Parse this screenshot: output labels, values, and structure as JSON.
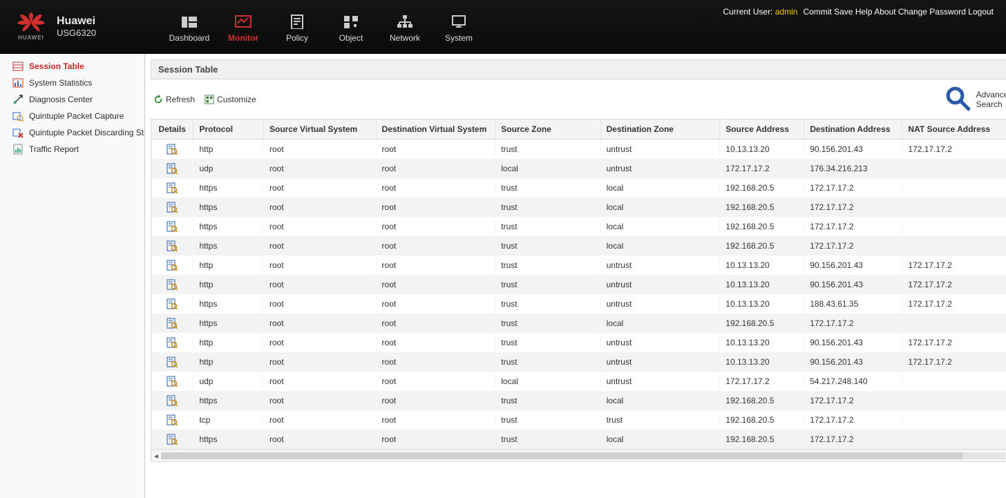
{
  "brand": {
    "name": "Huawei",
    "model": "USG6320",
    "logo_caption": "HUAWEI"
  },
  "top_right": {
    "current_user_label": "Current User:",
    "current_user": "admin",
    "links": [
      "Commit",
      "Save",
      "Help",
      "About",
      "Change Password",
      "Logout"
    ]
  },
  "nav": [
    {
      "label": "Dashboard",
      "id": "dashboard"
    },
    {
      "label": "Monitor",
      "id": "monitor",
      "active": true
    },
    {
      "label": "Policy",
      "id": "policy"
    },
    {
      "label": "Object",
      "id": "object"
    },
    {
      "label": "Network",
      "id": "network"
    },
    {
      "label": "System",
      "id": "system"
    }
  ],
  "sidebar": [
    {
      "label": "Session Table",
      "active": true,
      "icon": "session"
    },
    {
      "label": "System Statistics",
      "icon": "stats"
    },
    {
      "label": "Diagnosis Center",
      "icon": "diag"
    },
    {
      "label": "Quintuple Packet Capture",
      "icon": "pcap1"
    },
    {
      "label": "Quintuple Packet Discarding Statistics",
      "icon": "pcap2"
    },
    {
      "label": "Traffic Report",
      "icon": "report"
    }
  ],
  "panel": {
    "title": "Session Table",
    "refresh": "Refresh",
    "customize": "Customize",
    "advanced_search": "Advanced Search"
  },
  "columns": [
    "Details",
    "Protocol",
    "Source Virtual System",
    "Destination Virtual System",
    "Source Zone",
    "Destination Zone",
    "Source Address",
    "Destination Address",
    "NAT Source Address"
  ],
  "rows": [
    {
      "protocol": "http",
      "svs": "root",
      "dvs": "root",
      "sz": "trust",
      "dz": "untrust",
      "sa": "10.13.13.20",
      "da": "90.156.201.43",
      "nsa": "172.17.17.2"
    },
    {
      "protocol": "udp",
      "svs": "root",
      "dvs": "root",
      "sz": "local",
      "dz": "untrust",
      "sa": "172.17.17.2",
      "da": "176.34.216.213",
      "nsa": ""
    },
    {
      "protocol": "https",
      "svs": "root",
      "dvs": "root",
      "sz": "trust",
      "dz": "local",
      "sa": "192.168.20.5",
      "da": "172.17.17.2",
      "nsa": ""
    },
    {
      "protocol": "https",
      "svs": "root",
      "dvs": "root",
      "sz": "trust",
      "dz": "local",
      "sa": "192.168.20.5",
      "da": "172.17.17.2",
      "nsa": ""
    },
    {
      "protocol": "https",
      "svs": "root",
      "dvs": "root",
      "sz": "trust",
      "dz": "local",
      "sa": "192.168.20.5",
      "da": "172.17.17.2",
      "nsa": ""
    },
    {
      "protocol": "https",
      "svs": "root",
      "dvs": "root",
      "sz": "trust",
      "dz": "local",
      "sa": "192.168.20.5",
      "da": "172.17.17.2",
      "nsa": ""
    },
    {
      "protocol": "http",
      "svs": "root",
      "dvs": "root",
      "sz": "trust",
      "dz": "untrust",
      "sa": "10.13.13.20",
      "da": "90.156.201.43",
      "nsa": "172.17.17.2"
    },
    {
      "protocol": "http",
      "svs": "root",
      "dvs": "root",
      "sz": "trust",
      "dz": "untrust",
      "sa": "10.13.13.20",
      "da": "90.156.201.43",
      "nsa": "172.17.17.2"
    },
    {
      "protocol": "https",
      "svs": "root",
      "dvs": "root",
      "sz": "trust",
      "dz": "untrust",
      "sa": "10.13.13.20",
      "da": "188.43.61.35",
      "nsa": "172.17.17.2"
    },
    {
      "protocol": "https",
      "svs": "root",
      "dvs": "root",
      "sz": "trust",
      "dz": "local",
      "sa": "192.168.20.5",
      "da": "172.17.17.2",
      "nsa": ""
    },
    {
      "protocol": "http",
      "svs": "root",
      "dvs": "root",
      "sz": "trust",
      "dz": "untrust",
      "sa": "10.13.13.20",
      "da": "90.156.201.43",
      "nsa": "172.17.17.2"
    },
    {
      "protocol": "http",
      "svs": "root",
      "dvs": "root",
      "sz": "trust",
      "dz": "untrust",
      "sa": "10.13.13.20",
      "da": "90.156.201.43",
      "nsa": "172.17.17.2"
    },
    {
      "protocol": "udp",
      "svs": "root",
      "dvs": "root",
      "sz": "local",
      "dz": "untrust",
      "sa": "172.17.17.2",
      "da": "54.217.248.140",
      "nsa": ""
    },
    {
      "protocol": "https",
      "svs": "root",
      "dvs": "root",
      "sz": "trust",
      "dz": "local",
      "sa": "192.168.20.5",
      "da": "172.17.17.2",
      "nsa": ""
    },
    {
      "protocol": "tcp",
      "svs": "root",
      "dvs": "root",
      "sz": "trust",
      "dz": "trust",
      "sa": "192.168.20.5",
      "da": "172.17.17.2",
      "nsa": ""
    },
    {
      "protocol": "https",
      "svs": "root",
      "dvs": "root",
      "sz": "trust",
      "dz": "local",
      "sa": "192.168.20.5",
      "da": "172.17.17.2",
      "nsa": ""
    }
  ]
}
